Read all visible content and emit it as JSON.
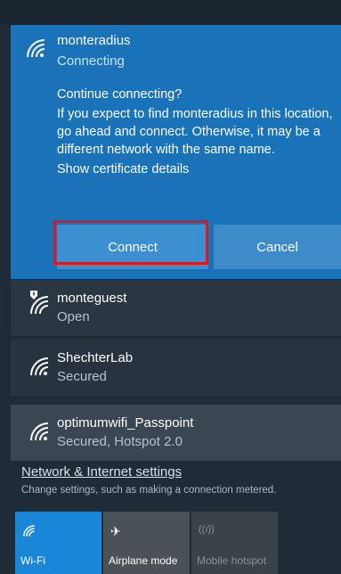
{
  "selected_network": {
    "name": "monteradius",
    "status": "Connecting",
    "prompt_question": "Continue connecting?",
    "prompt_body": "If you expect to find monteradius in this location, go ahead and connect. Otherwise, it may be a different network with the same name.",
    "certificate_link": "Show certificate details",
    "connect_label": "Connect",
    "cancel_label": "Cancel"
  },
  "networks": [
    {
      "name": "monteguest",
      "status": "Open",
      "icon": "wifi-warning-icon"
    },
    {
      "name": "ShechterLab",
      "status": "Secured",
      "icon": "wifi-icon"
    },
    {
      "name": "optimumwifi_Passpoint",
      "status": "Secured, Hotspot 2.0",
      "icon": "wifi-icon"
    }
  ],
  "settings": {
    "link": "Network & Internet settings",
    "description": "Change settings, such as making a connection metered."
  },
  "quick_actions": [
    {
      "label": "Wi-Fi",
      "icon": "wifi-icon",
      "state": "on"
    },
    {
      "label": "Airplane mode",
      "icon": "airplane-icon",
      "state": "off"
    },
    {
      "label": "Mobile hotspot",
      "icon": "hotspot-icon",
      "state": "disabled"
    }
  ],
  "colors": {
    "accent": "#1a72b8",
    "highlight_border": "#e0161e",
    "tile_active": "#1a86d8"
  }
}
